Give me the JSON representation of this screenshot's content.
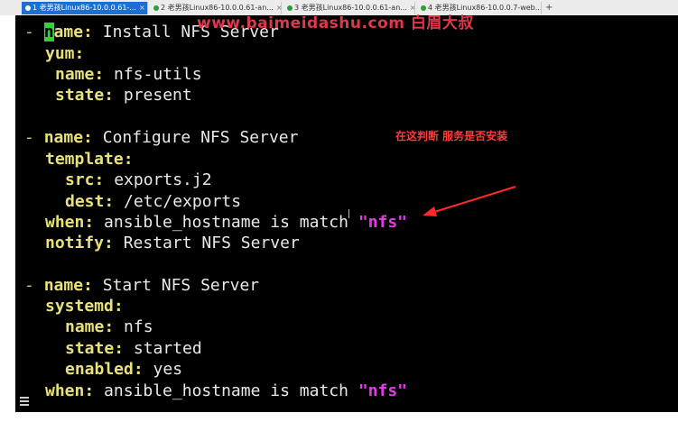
{
  "tabs": [
    {
      "label": "1 老男孩Linux86-10.0.0.61-...",
      "dot_color": "#ffffff",
      "active": true
    },
    {
      "label": "2 老男孩Linux86-10.0.0.61-an...",
      "dot_color": "#2a9d3a",
      "active": false
    },
    {
      "label": "3 老男孩Linux86-10.0.0.61-an...",
      "dot_color": "#2a9d3a",
      "active": false
    },
    {
      "label": "4 老男孩Linux86-10.0.0.7-web...",
      "dot_color": "#2a9d3a",
      "active": false
    }
  ],
  "new_tab_label": "+",
  "watermark": "www.baimeidashu.com 白眉大叔",
  "annotation": "在这判断 服务是否安装",
  "colors": {
    "key": "#e8e07a",
    "string": "#e23be8",
    "annotation": "#ff3b3b",
    "cursor": "#2fd13c"
  },
  "code": {
    "l1_dash": "- ",
    "l1_cursor": "n",
    "l1_key": "ame",
    "l1_colon": ":",
    "l1_val": " Install NFS Server",
    "l2_key": "yum",
    "l2_colon": ":",
    "l3_key": "name",
    "l3_colon": ":",
    "l3_val": " nfs-utils",
    "l4_key": "state",
    "l4_colon": ":",
    "l4_val": " present",
    "l5_dash": "- ",
    "l5_key": "name",
    "l5_colon": ":",
    "l5_val": " Configure NFS Server",
    "l6_key": "template",
    "l6_colon": ":",
    "l7_key": "src",
    "l7_colon": ":",
    "l7_val": " exports.j2",
    "l8_key": "dest",
    "l8_colon": ":",
    "l8_val": " /etc/exports",
    "l9_key": "when",
    "l9_colon": ":",
    "l9_val": " ansible_hostname is match ",
    "l9_str": "\"nfs\"",
    "l10_key": "notify",
    "l10_colon": ":",
    "l10_val": " Restart NFS Server",
    "l11_dash": "- ",
    "l11_key": "name",
    "l11_colon": ":",
    "l11_val": " Start NFS Server",
    "l12_key": "systemd",
    "l12_colon": ":",
    "l13_key": "name",
    "l13_colon": ":",
    "l13_val": " nfs",
    "l14_key": "state",
    "l14_colon": ":",
    "l14_val": " started",
    "l15_key": "enabled",
    "l15_colon": ":",
    "l15_val": " yes",
    "l16_key": "when",
    "l16_colon": ":",
    "l16_val": " ansible_hostname is match ",
    "l16_str": "\"nfs\""
  }
}
